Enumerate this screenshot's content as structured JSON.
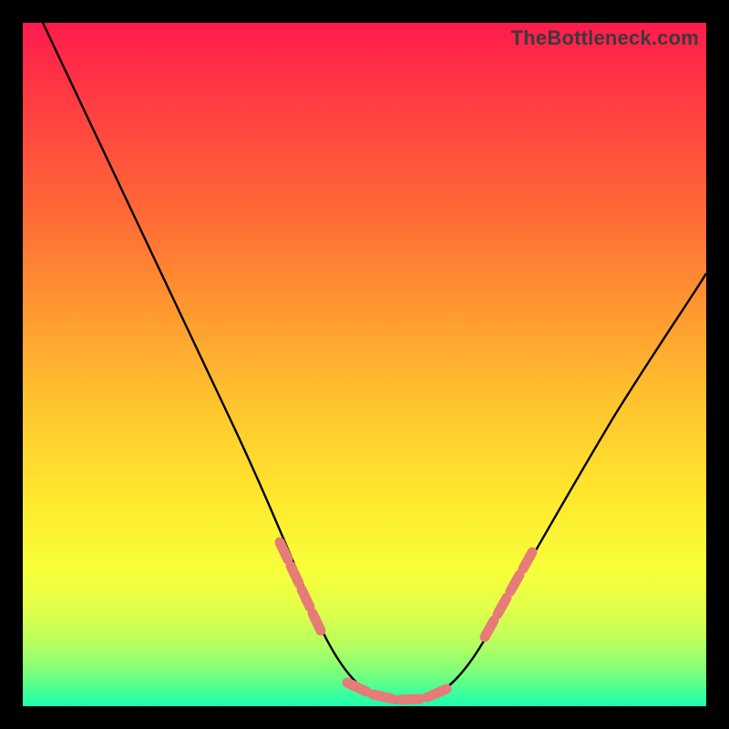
{
  "watermark": {
    "text": "TheBottleneck.com"
  },
  "chart_data": {
    "type": "line",
    "title": "",
    "xlabel": "",
    "ylabel": "",
    "xlim": [
      0,
      100
    ],
    "ylim": [
      0,
      100
    ],
    "grid": false,
    "legend": false,
    "series": [
      {
        "name": "curve",
        "color": "#000000",
        "x": [
          3,
          8,
          14,
          20,
          26,
          32,
          38,
          41,
          44,
          47,
          50,
          53,
          56,
          59,
          62,
          66,
          70,
          75,
          80,
          86,
          92,
          98
        ],
        "y": [
          100,
          89,
          76,
          63,
          51,
          38,
          25,
          19,
          13,
          8,
          4,
          2,
          1,
          1,
          2,
          5,
          10,
          17,
          25,
          35,
          45,
          55
        ]
      }
    ],
    "markers": {
      "name": "pink-dash-markers",
      "color": "#e77b77",
      "segments_x": [
        [
          38,
          40.5
        ],
        [
          40.5,
          43
        ],
        [
          47.5,
          50.5
        ],
        [
          51,
          54
        ],
        [
          55.5,
          58.5
        ],
        [
          59.5,
          62.5
        ],
        [
          68,
          70.5
        ],
        [
          70.5,
          73
        ],
        [
          73,
          75.5
        ]
      ],
      "approx_y_at_segment_midpoints": [
        23,
        17,
        3,
        1.5,
        1,
        2,
        12,
        16,
        20
      ]
    },
    "background_gradient": {
      "top": "#ff1a4d",
      "mid": "#ffe92e",
      "bottom": "#1affb0"
    }
  }
}
